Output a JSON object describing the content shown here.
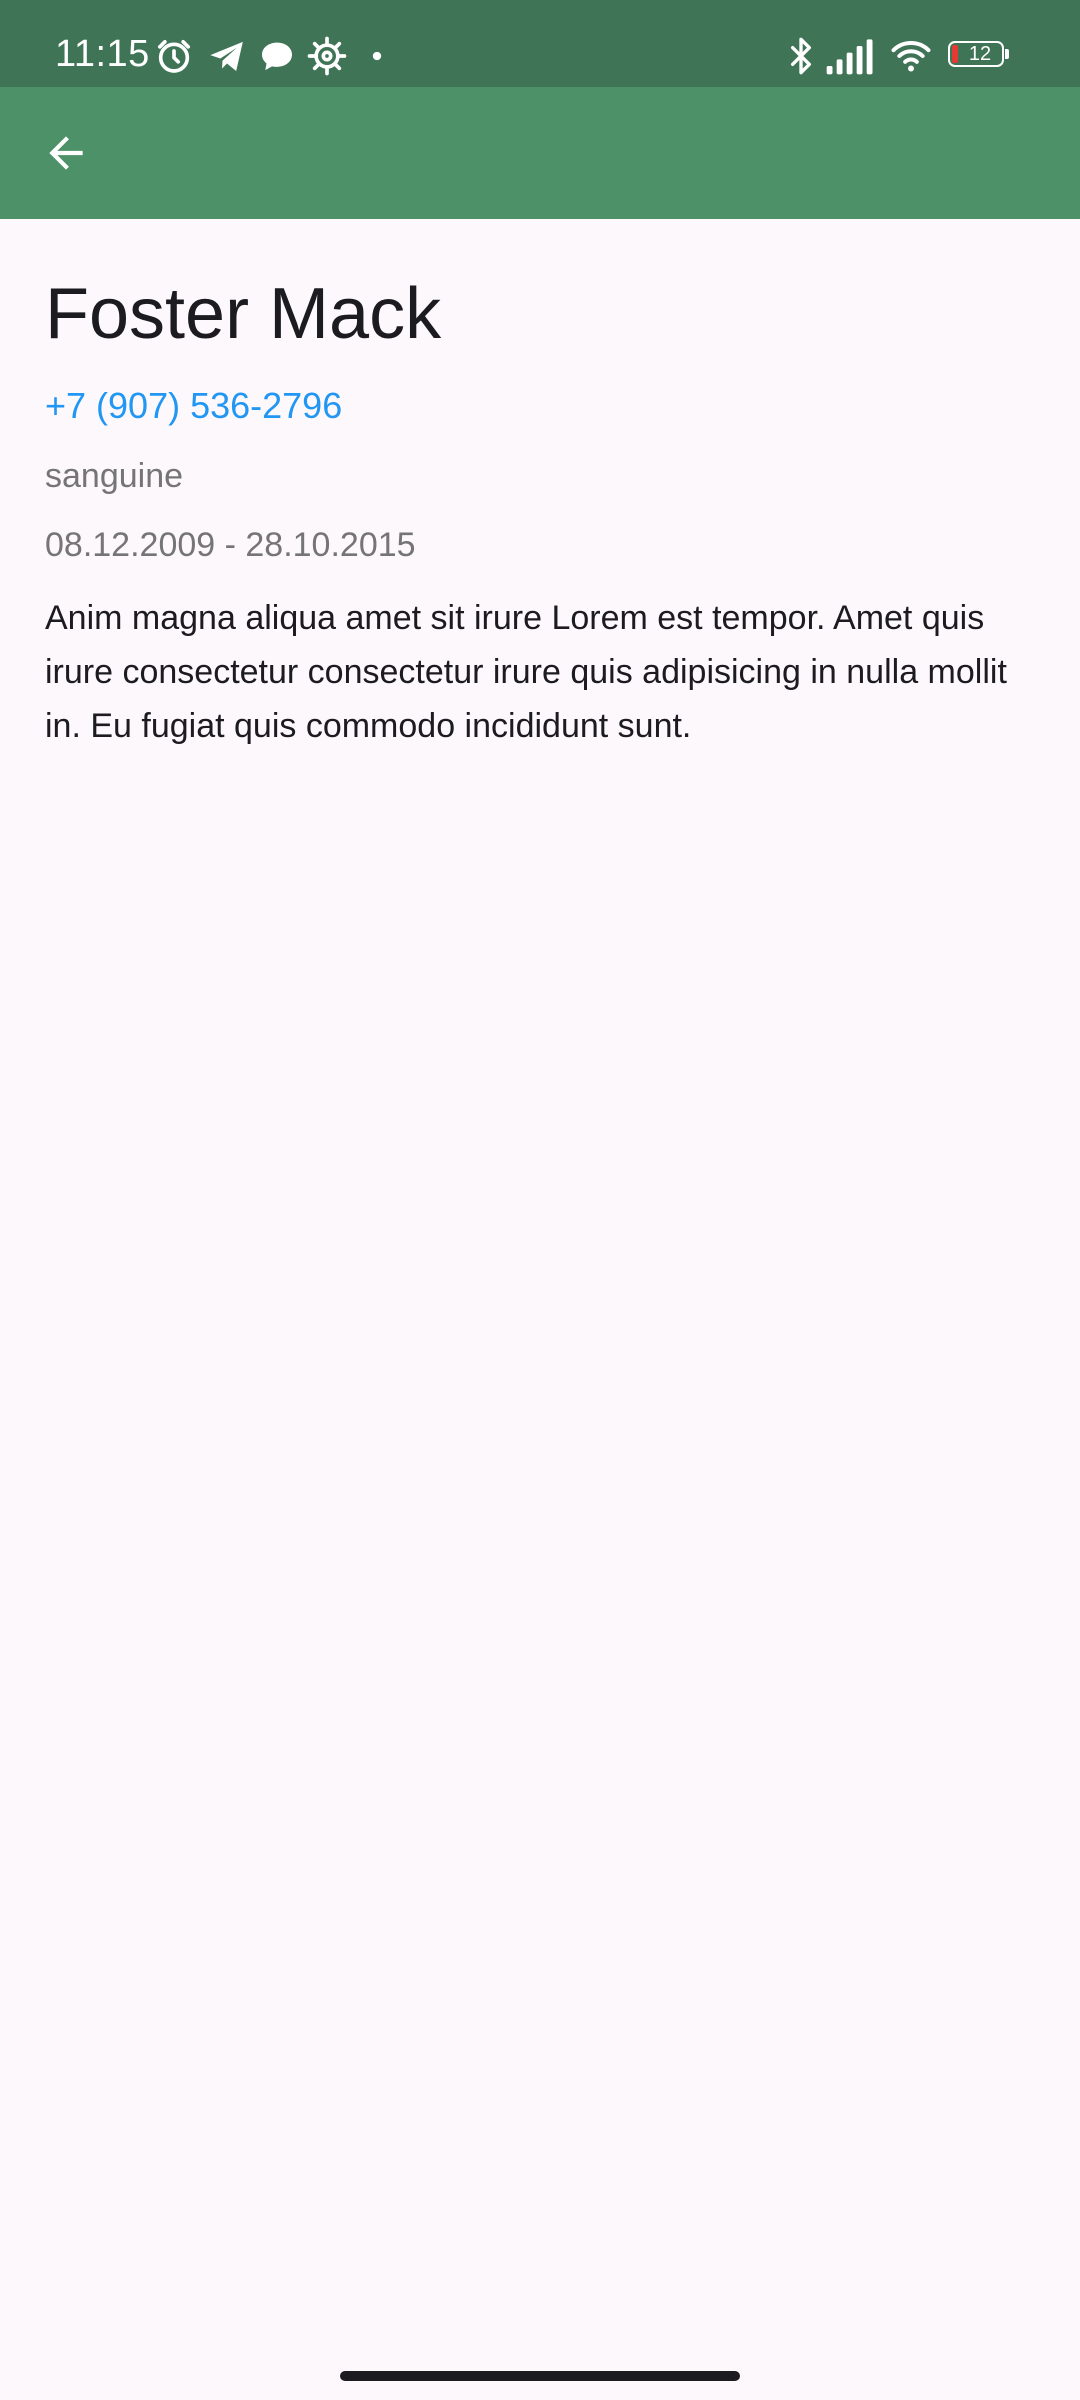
{
  "status_bar": {
    "time": "11:15",
    "battery_level": "12",
    "icons": [
      "alarm-icon",
      "telegram-icon",
      "message-icon",
      "settings-icon",
      "dot-icon",
      "bluetooth-icon",
      "signal-icon",
      "wifi-icon",
      "battery-icon"
    ]
  },
  "app_bar": {
    "back_icon": "arrow-back-icon",
    "color": "#4d9168"
  },
  "contact": {
    "name": "Foster Mack",
    "phone": "+7 (907) 536-2796",
    "temperament": "sanguine",
    "period": "08.12.2009 - 28.10.2015",
    "biography": "Anim magna aliqua amet sit irure Lorem est tempor. Amet quis irure consectetur consectetur irure quis adipisicing in nulla mollit in. Eu fugiat quis commodo incididunt sunt."
  },
  "colors": {
    "status_bar": "#3f7556",
    "app_bar": "#4d9168",
    "phone_link": "#2196f3",
    "secondary_text": "#757575",
    "background": "#fdf8fc"
  }
}
